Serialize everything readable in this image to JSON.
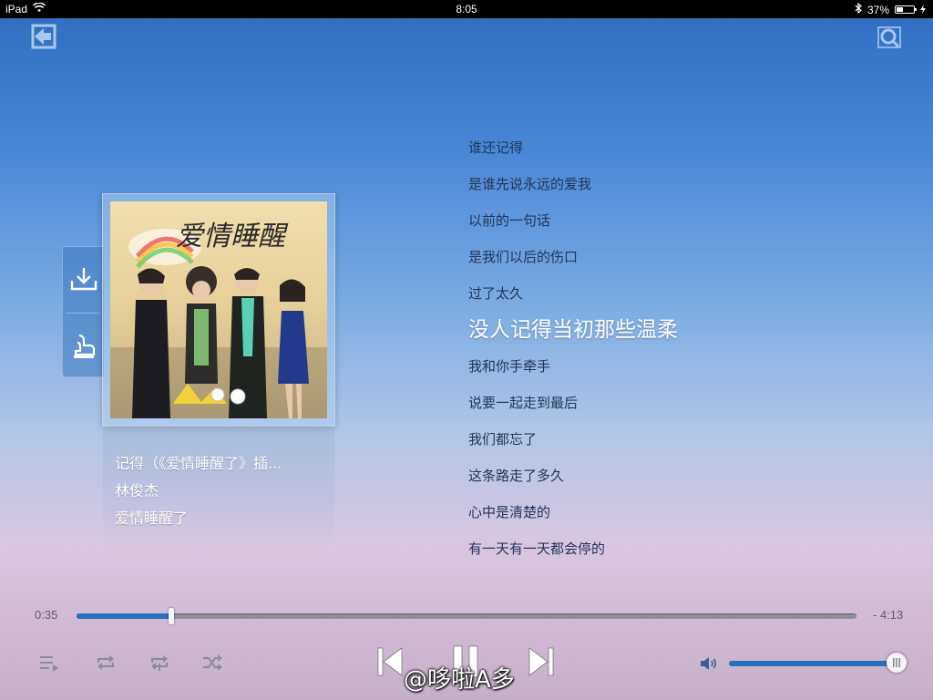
{
  "status_bar": {
    "device": "iPad",
    "time": "8:05",
    "battery_text": "37%",
    "battery_level": 0.37
  },
  "album": {
    "title_art_text": "爱情睡醒"
  },
  "track": {
    "title": "记得（《爱情睡醒了》插...",
    "artist": "林俊杰",
    "album": "爱情睡醒了"
  },
  "lyrics": {
    "lines": [
      "谁还记得",
      "是谁先说永远的爱我",
      "以前的一句话",
      "是我们以后的伤口",
      "过了太久",
      "没人记得当初那些温柔",
      "我和你手牵手",
      "说要一起走到最后",
      "我们都忘了",
      "这条路走了多久",
      "心中是清楚的",
      "有一天有一天都会停的"
    ],
    "current_index": 5
  },
  "playback": {
    "elapsed": "0:35",
    "remaining": "- 4:13",
    "progress": 0.122
  },
  "volume": {
    "level": 0.99
  },
  "watermark": "@哆啦A多",
  "icons": {
    "back": "back-arrow-icon",
    "search": "search-icon",
    "download": "download-icon",
    "share": "share-icon",
    "playlist": "playlist-icon",
    "repeat": "repeat-icon",
    "repeat_one": "repeat-one-icon",
    "shuffle": "shuffle-icon",
    "prev": "previous-icon",
    "pause": "pause-icon",
    "next": "next-icon",
    "volume": "speaker-icon"
  },
  "colors": {
    "accent": "#2a6fbe",
    "lyric_text": "#21365a",
    "lyric_current": "#ffffff"
  }
}
